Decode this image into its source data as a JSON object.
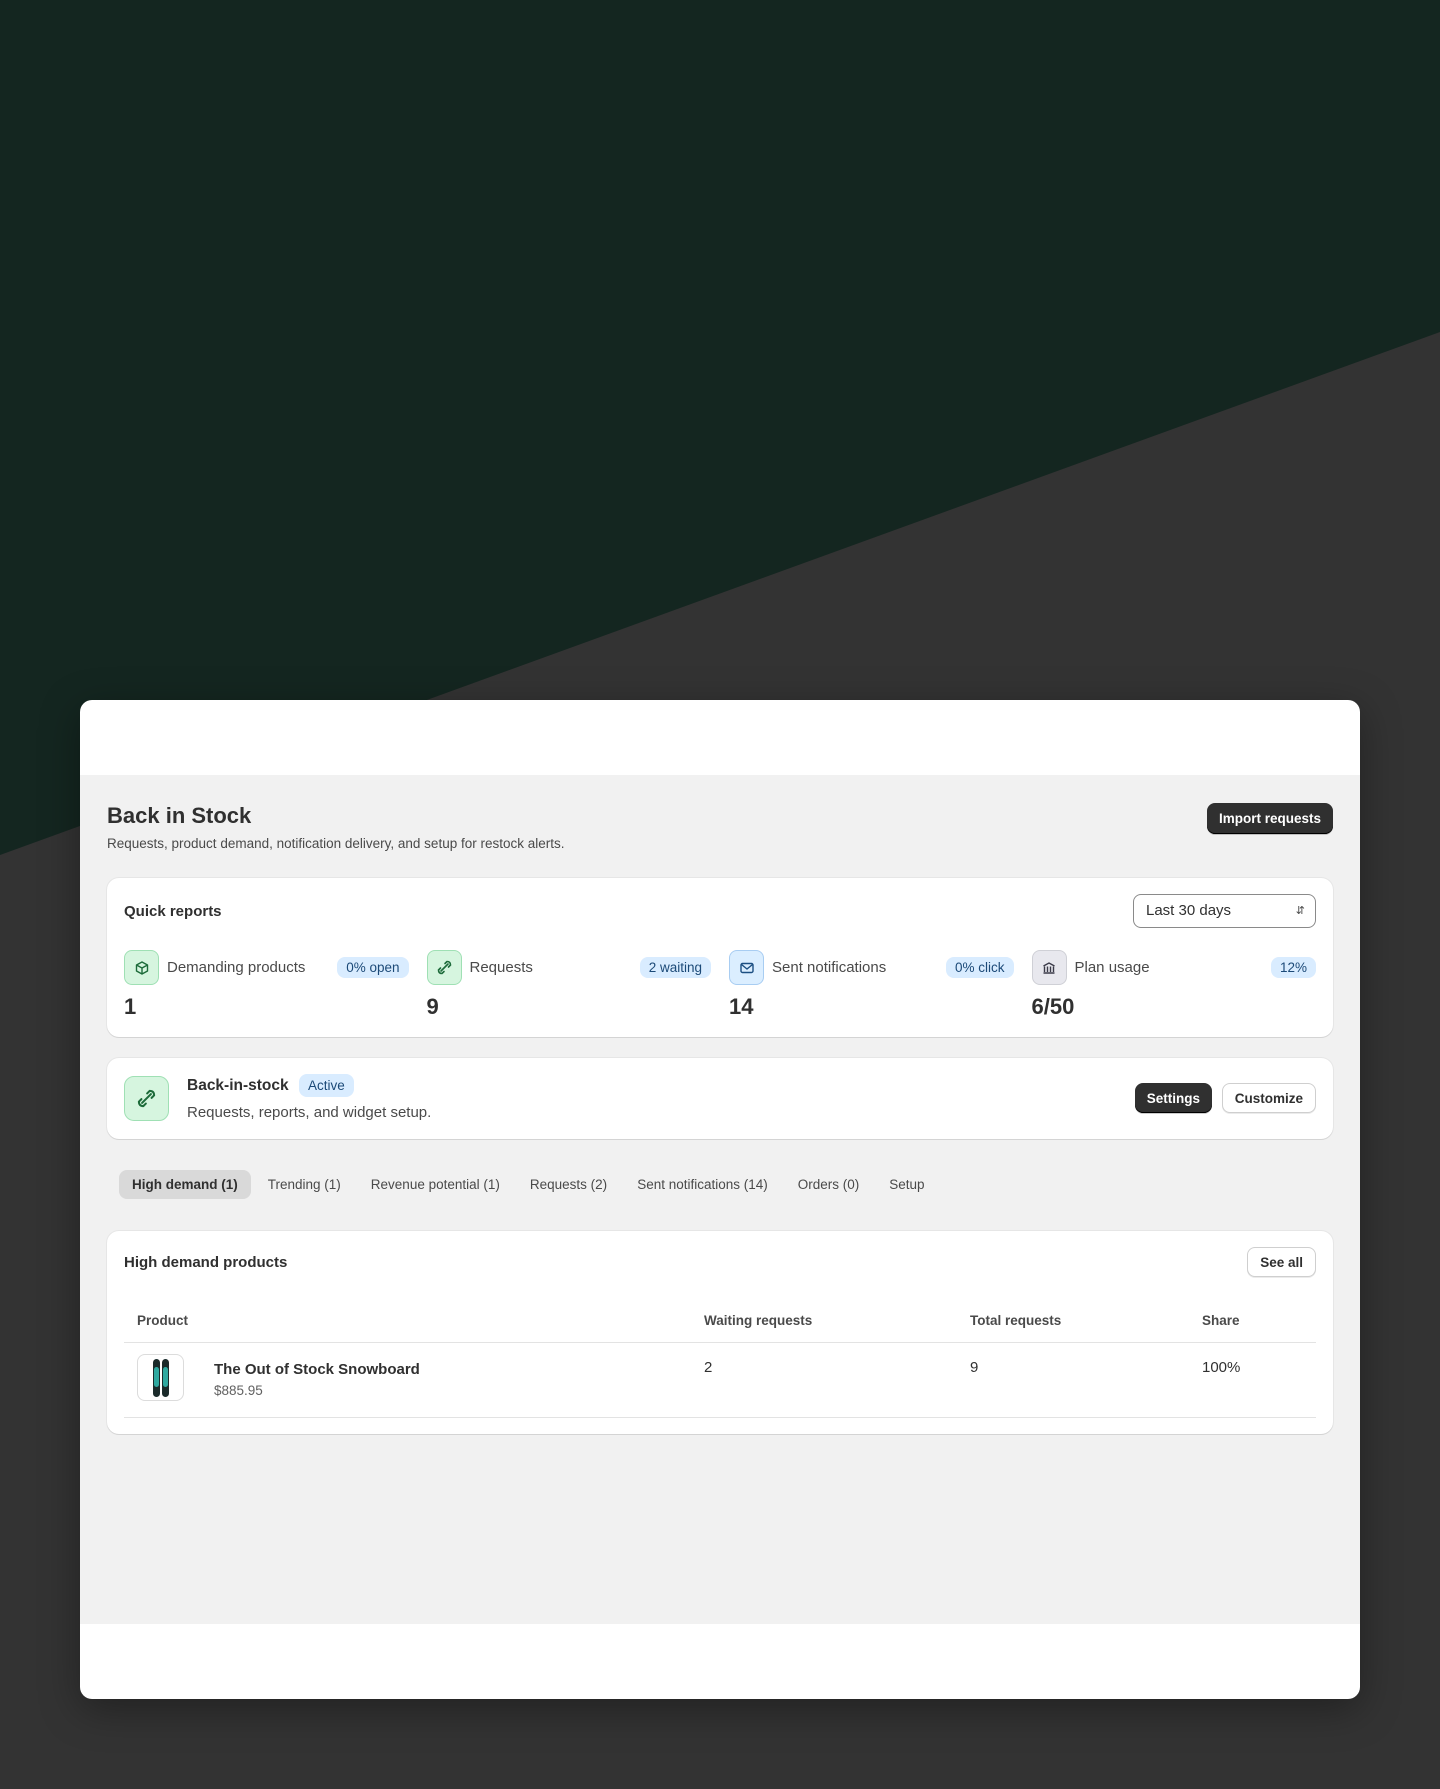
{
  "page": {
    "title": "Back in Stock",
    "subtitle": "Requests, product demand, notification delivery, and setup for restock alerts.",
    "import_label": "Import requests"
  },
  "quick_reports": {
    "title": "Quick reports",
    "period": "Last 30 days",
    "metrics": [
      {
        "label": "Demanding products",
        "badge": "0% open",
        "value": "1",
        "icon": "cube-icon"
      },
      {
        "label": "Requests",
        "badge": "2 waiting",
        "value": "9",
        "icon": "link-icon"
      },
      {
        "label": "Sent notifications",
        "badge": "0% click",
        "value": "14",
        "icon": "mail-icon"
      },
      {
        "label": "Plan usage",
        "badge": "12%",
        "value": "6/50",
        "icon": "bank-icon"
      }
    ]
  },
  "widget": {
    "title": "Back-in-stock",
    "status": "Active",
    "subtitle": "Requests, reports, and widget setup.",
    "settings_label": "Settings",
    "customize_label": "Customize",
    "icon": "link-icon"
  },
  "tabs": [
    {
      "label": "High demand (1)",
      "active": true
    },
    {
      "label": "Trending (1)"
    },
    {
      "label": "Revenue potential (1)"
    },
    {
      "label": "Requests (2)"
    },
    {
      "label": "Sent notifications (14)"
    },
    {
      "label": "Orders (0)"
    },
    {
      "label": "Setup"
    }
  ],
  "demand": {
    "title": "High demand products",
    "see_all_label": "See all",
    "columns": [
      "Product",
      "Waiting requests",
      "Total requests",
      "Share"
    ],
    "rows": [
      {
        "product": "The Out of Stock Snowboard",
        "price": "$885.95",
        "waiting": "2",
        "total": "9",
        "share": "100%"
      }
    ]
  },
  "colors": {
    "bg_dark": "#142620",
    "bg_gray": "#333333",
    "badge_blue": "#d9ecff",
    "icon_green": "#d6f5df"
  }
}
